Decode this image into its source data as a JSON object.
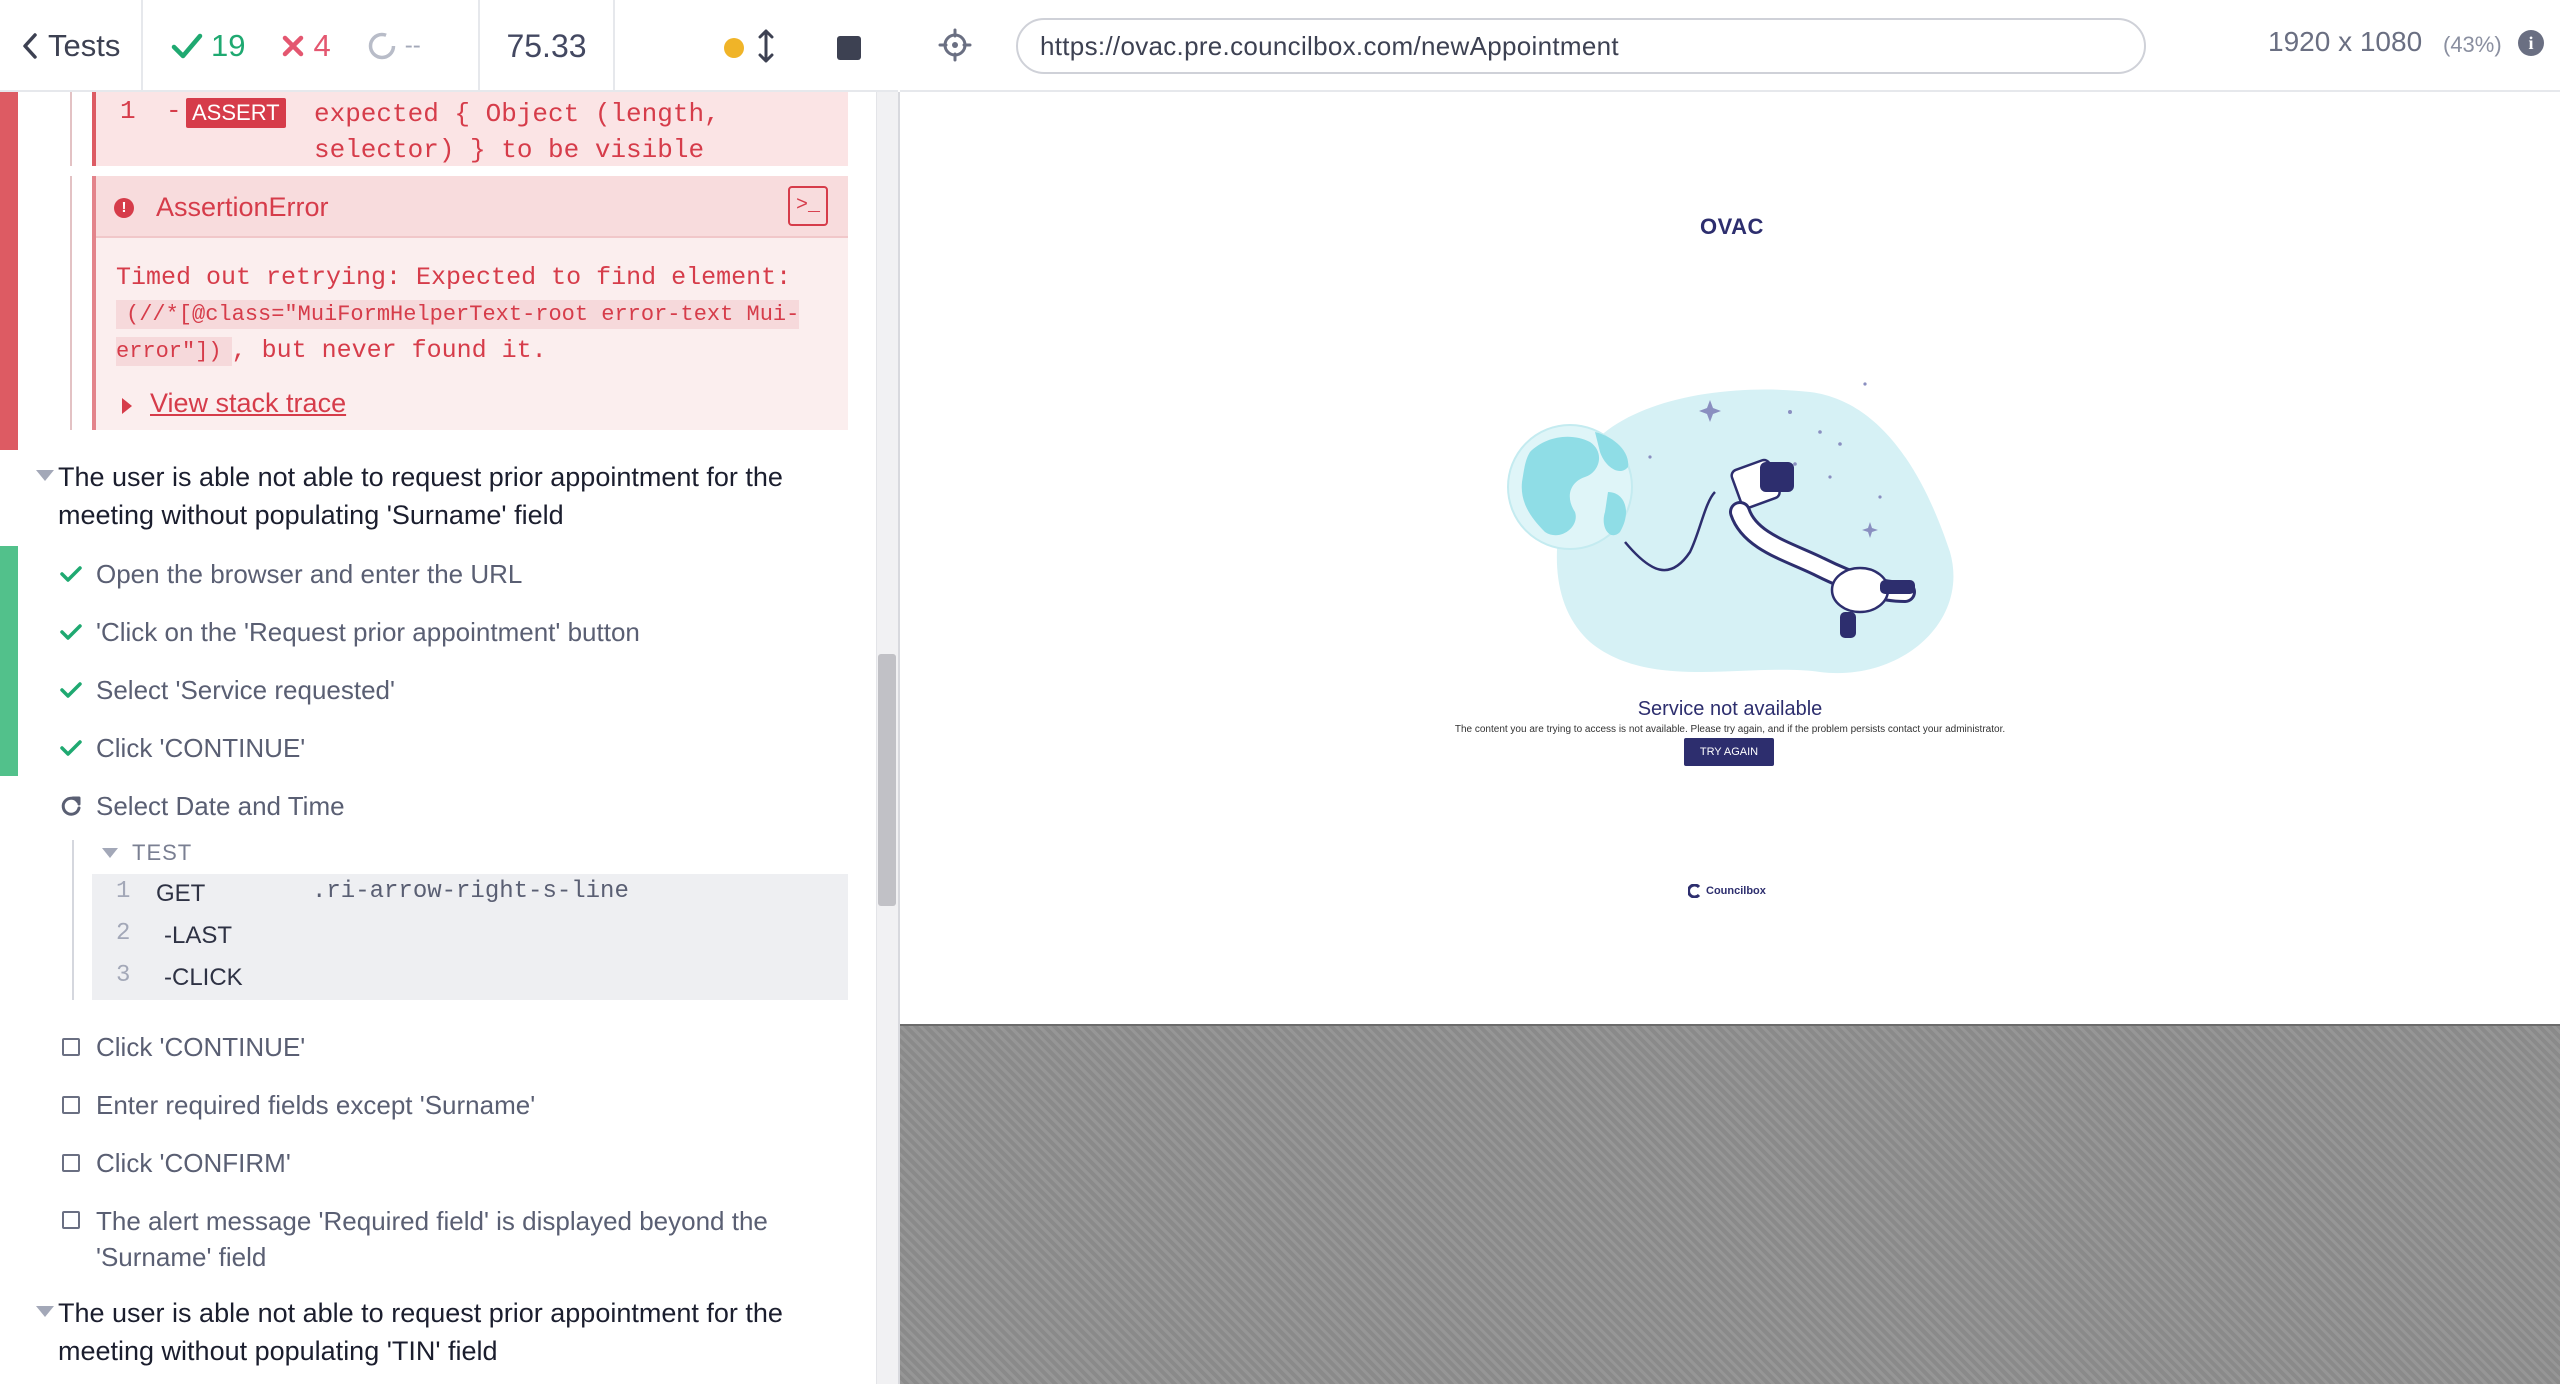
{
  "reporter": {
    "back_label": "Tests",
    "passed": "19",
    "failed": "4",
    "pending": "--",
    "duration": "75.33"
  },
  "command_log": {
    "assert": {
      "number": "1",
      "dash": "-",
      "badge": "ASSERT",
      "message": "expected { Object (length, selector) } to be visible"
    },
    "error": {
      "title": "AssertionError",
      "terminal_icon": ">_",
      "message_prefix": "Timed out retrying: Expected to find element: ",
      "message_code": "(//*[@class=\"MuiFormHelperText-root error-text Mui-error\"])",
      "message_suffix": ", but never found it.",
      "stack_trace_label": "View stack trace"
    },
    "suite_surname": {
      "title": "The user is able not able to request prior appointment for the meeting without populating 'Surname' field",
      "steps": [
        {
          "label": "Open the browser and enter the URL",
          "state": "passed"
        },
        {
          "label": "'Click on the 'Request prior appointment' button",
          "state": "passed"
        },
        {
          "label": "Select 'Service requested'",
          "state": "passed"
        },
        {
          "label": "Click 'CONTINUE'",
          "state": "passed"
        },
        {
          "label": "Select Date and Time",
          "state": "running"
        },
        {
          "label": "Click 'CONTINUE'",
          "state": "pending"
        },
        {
          "label": "Enter required fields except 'Surname'",
          "state": "pending"
        },
        {
          "label": "Click 'CONFIRM'",
          "state": "pending"
        },
        {
          "label": "The alert message 'Required field' is displayed beyond the 'Surname' field",
          "state": "pending"
        }
      ],
      "test_label": "TEST",
      "commands": [
        {
          "num": "1",
          "name": "GET",
          "arg": ".ri-arrow-right-s-line"
        },
        {
          "num": "2",
          "name": "-LAST",
          "arg": ""
        },
        {
          "num": "3",
          "name": "-CLICK",
          "arg": ""
        }
      ]
    },
    "suite_tin": {
      "title": "The user is able not able to request prior appointment for the meeting without populating 'TIN' field"
    }
  },
  "browser": {
    "url": "https://ovac.pre.councilbox.com/newAppointment",
    "viewport_size": "1920 x 1080",
    "viewport_scale": "(43%)",
    "info_icon": "i"
  },
  "app": {
    "logo": "OVAC",
    "service_title": "Service not available",
    "service_message": "The content you are trying to access is not available. Please try again, and if the problem persists contact your administrator.",
    "try_again_label": "TRY AGAIN",
    "footer_logo": "Councilbox"
  },
  "colors": {
    "passed": "#1fa971",
    "failed": "#e45770",
    "running_dot": "#f0b428",
    "brand_navy": "#2d2e6e",
    "illustration_blob": "#d6f1f5",
    "globe": "#8fdde6"
  }
}
